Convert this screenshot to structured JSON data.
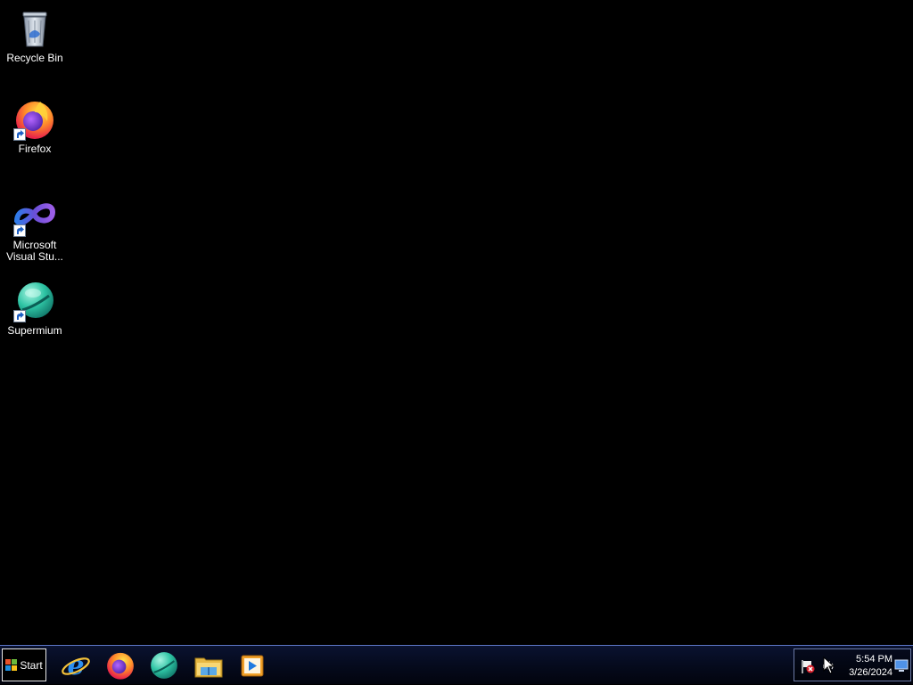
{
  "desktop": {
    "icons": [
      {
        "label": "Recycle Bin",
        "icon": "recycle-bin-icon"
      },
      {
        "label": "Firefox",
        "icon": "firefox-icon"
      },
      {
        "label": "Microsoft Visual Stu...",
        "icon": "visual-studio-icon"
      },
      {
        "label": "Supermium",
        "icon": "supermium-icon"
      }
    ]
  },
  "taskbar": {
    "start_label": "Start",
    "quick_launch": [
      {
        "icon": "internet-explorer-icon"
      },
      {
        "icon": "firefox-icon"
      },
      {
        "icon": "supermium-icon"
      },
      {
        "icon": "file-explorer-icon"
      },
      {
        "icon": "media-player-icon"
      }
    ],
    "tray": {
      "icons": [
        "action-center-flag-icon",
        "volume-icon"
      ],
      "time": "5:54 PM",
      "date": "3/26/2024",
      "show_desktop_icon": "show-desktop-icon"
    }
  },
  "colors": {
    "desktop_bg": "#000000",
    "taskbar_top": "#0a1230",
    "taskbar_border": "#5d77c8"
  }
}
